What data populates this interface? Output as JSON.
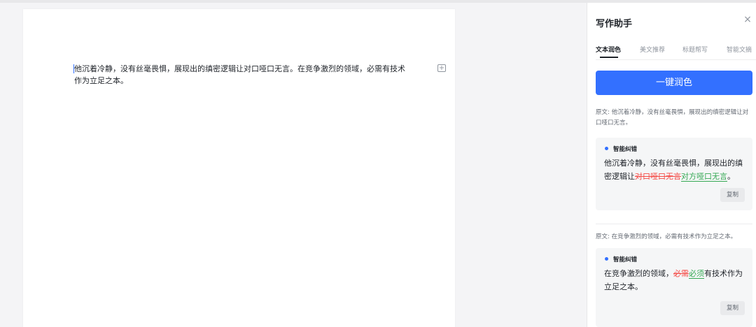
{
  "document": {
    "paragraph": "他沉着冷静，没有丝毫畏惧，展现出的缜密逻辑让对口哑口无言。在竞争激烈的领域，必需有技术作为立足之本。"
  },
  "panel": {
    "title": "写作助手",
    "tabs": [
      "文本润色",
      "美文推荐",
      "标题帮写",
      "智能文摘"
    ],
    "active_tab": "文本润色",
    "polish_button": "一键润色",
    "suggestions": [
      {
        "original": "原文: 他沉着冷静，没有丝毫畏惧，展现出的缜密逻辑让对口哑口无言。",
        "tag": "智能纠错",
        "text_before": "他沉着冷静，没有丝毫畏惧，展现出的缜密逻辑让",
        "deleted": "对口哑口无言",
        "inserted": "对方哑口无言",
        "text_after": "。",
        "copy": "复制"
      },
      {
        "original": "原文: 在竞争激烈的领域，必需有技术作为立足之本。",
        "tag": "智能纠错",
        "text_before": "在竞争激烈的领域，",
        "deleted": "必需",
        "inserted": "必须",
        "text_after": "有技术作为立足之本。",
        "copy": "复制"
      }
    ]
  },
  "colors": {
    "accent": "#3370ff",
    "deleted": "#f54a45",
    "inserted": "#34a853"
  },
  "icons": [
    "close-icon",
    "paragraph-add-icon"
  ]
}
